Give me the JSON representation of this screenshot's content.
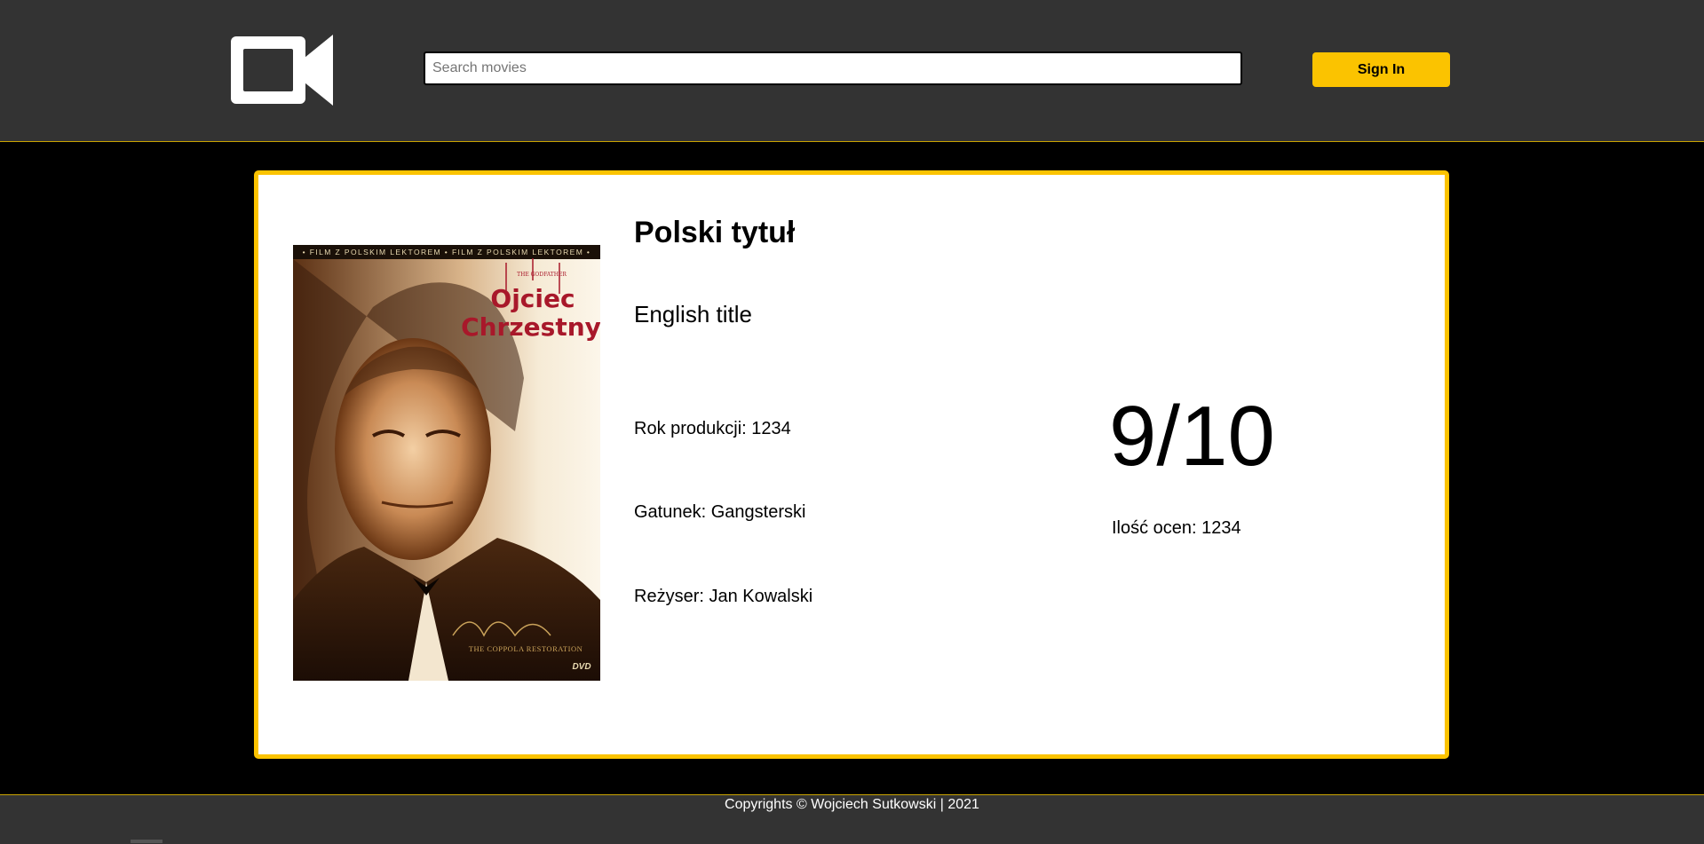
{
  "header": {
    "logo_icon": "video-camera-icon",
    "search": {
      "placeholder": "Search movies",
      "value": ""
    },
    "signin_label": "Sign In"
  },
  "movie": {
    "title_pl": "Polski tytuł",
    "title_en": "English title",
    "year": "Rok produkcji: 1234",
    "genre": "Gatunek: Gangsterski",
    "director": "Reżyser: Jan Kowalski",
    "rating": "9/10",
    "votes": "Ilość ocen: 1234",
    "poster": {
      "top_banner": "• FILM Z POLSKIM LEKTOREM • FILM Z POLSKIM LEKTOREM •",
      "series": "THE GODFATHER",
      "title_line1": "Ojciec",
      "title_line2": "Chrzestny",
      "restoration": "THE COPPOLA RESTORATION",
      "format": "DVD"
    }
  },
  "footer": {
    "copyright": "Copyrights © Wojciech Sutkowski | 2021"
  },
  "colors": {
    "accent": "#fbc300",
    "header_bg": "#333333",
    "page_bg": "#000000",
    "card_bg": "#ffffff",
    "poster_title": "#a8182a"
  }
}
